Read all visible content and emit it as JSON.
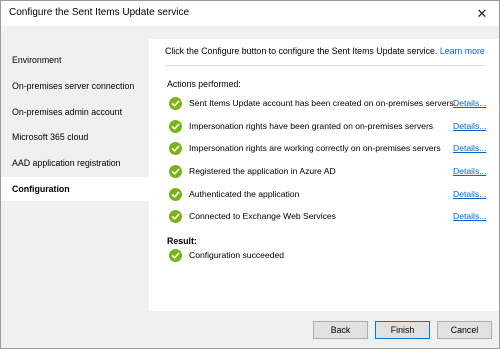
{
  "window": {
    "title": "Configure the Sent Items Update service"
  },
  "sidebar": {
    "items": [
      {
        "label": "Environment",
        "selected": false
      },
      {
        "label": "On-premises server connection",
        "selected": false
      },
      {
        "label": "On-premises admin account",
        "selected": false
      },
      {
        "label": "Microsoft 365 cloud",
        "selected": false
      },
      {
        "label": "AAD application registration",
        "selected": false
      },
      {
        "label": "Configuration",
        "selected": true
      }
    ]
  },
  "main": {
    "intro": "Click the Configure button to configure the Sent Items Update service.",
    "learn_more": "Learn more",
    "actions_label": "Actions performed:",
    "actions": [
      {
        "text": "Sent Items Update account has been created on on-premises servers",
        "details": "Details..."
      },
      {
        "text": "Impersonation rights have been granted on on-premises servers",
        "details": "Details..."
      },
      {
        "text": "Impersonation rights are working correctly on on-premises servers",
        "details": "Details..."
      },
      {
        "text": "Registered the application in Azure AD",
        "details": "Details..."
      },
      {
        "text": "Authenticated the application",
        "details": "Details..."
      },
      {
        "text": "Connected to Exchange Web Services",
        "details": "Details..."
      }
    ],
    "result_label": "Result:",
    "result": "Configuration succeeded"
  },
  "footer": {
    "back": "Back",
    "finish": "Finish",
    "cancel": "Cancel"
  },
  "colors": {
    "success_green": "#7ab317",
    "link_blue": "#0066cc",
    "focus_blue": "#0078d7"
  }
}
